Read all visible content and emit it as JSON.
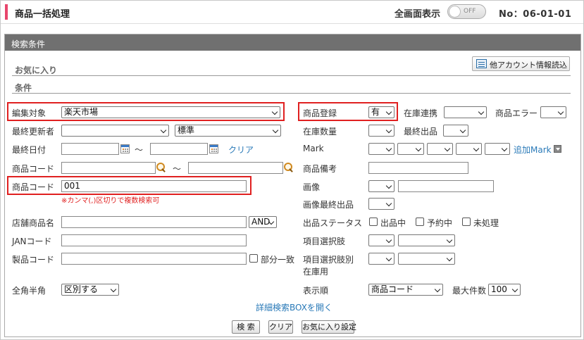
{
  "header": {
    "title": "商品一括処理",
    "fullscreen_label": "全画面表示",
    "toggle_state": "OFF",
    "page_number": "No：06-01-01"
  },
  "panel": {
    "title": "検索条件",
    "favorites_label": "お気に入り",
    "conditions_label": "条件",
    "other_account_button": "他アカウント情報読込"
  },
  "left": {
    "edit_target_label": "編集対象",
    "edit_target_value": "楽天市場",
    "last_updater_label": "最終更新者",
    "last_updater_value": "",
    "last_updater_mode": "標準",
    "last_date_label": "最終日付",
    "tilde": "～",
    "clear_link": "クリア",
    "product_code_label": "商品コード",
    "product_code2_label": "商品コード",
    "product_code2_value": "001",
    "product_code2_note": "※カンマ(,)区切りで複数検索可",
    "store_product_name_label": "店舗商品名",
    "and_value": "AND",
    "jan_label": "JANコード",
    "maker_code_label": "製品コード",
    "partial_match_label": "部分一致",
    "fullhalf_label": "全角半角",
    "fullhalf_value": "区別する"
  },
  "right": {
    "product_reg_label": "商品登録",
    "product_reg_value": "有",
    "stock_link_label": "在庫連携",
    "product_error_label": "商品エラー",
    "stock_qty_label": "在庫数量",
    "last_listing_label": "最終出品",
    "mark_label": "Mark",
    "add_mark_link": "追加Mark",
    "product_note_label": "商品備考",
    "image_label": "画像",
    "image_last_listing_label": "画像最終出品",
    "listing_status_label": "出品ステータス",
    "status_listing": "出品中",
    "status_reserved": "予約中",
    "status_unprocessed": "未処理",
    "item_option_label": "項目選択肢",
    "item_option_stock_label1": "項目選択肢別",
    "item_option_stock_label2": "在庫用",
    "sort_label": "表示順",
    "sort_value": "商品コード",
    "max_count_label": "最大件数",
    "max_count_value": "100"
  },
  "footer": {
    "detail_link": "詳細検索BOXを開く",
    "search_button": "検 索",
    "clear_button": "クリア",
    "favorite_button": "お気に入り設定"
  },
  "colors": {
    "accent": "#e8466c",
    "highlight": "#e02020",
    "panel_header": "#707070",
    "link": "#2a7ab8"
  }
}
